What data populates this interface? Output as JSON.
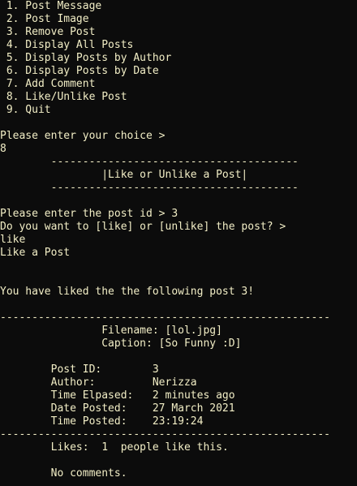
{
  "console": {
    "lines": [
      " 1. Post Message",
      " 2. Post Image",
      " 3. Remove Post",
      " 4. Display All Posts",
      " 5. Display Posts by Author",
      " 6. Display Posts by Date",
      " 7. Add Comment",
      " 8. Like/Unlike Post",
      " 9. Quit",
      "",
      "Please enter your choice >",
      "8",
      "        ---------------------------------------",
      "                |Like or Unlike a Post|",
      "        ---------------------------------------",
      "",
      "Please enter the post id > 3",
      "Do you want to [like] or [unlike] the post? >",
      "like",
      "Like a Post",
      "",
      "",
      "You have liked the the following post 3!",
      "",
      "----------------------------------------------------",
      "                Filename: [lol.jpg]",
      "                Caption: [So Funny :D]",
      "",
      "        Post ID:        3",
      "        Author:         Nerizza",
      "        Time Elpased:   2 minutes ago",
      "        Date Posted:    27 March 2021",
      "        Time Posted:    23:19:24",
      "----------------------------------------------------",
      "        Likes:  1  people like this.",
      "",
      "        No comments."
    ]
  }
}
